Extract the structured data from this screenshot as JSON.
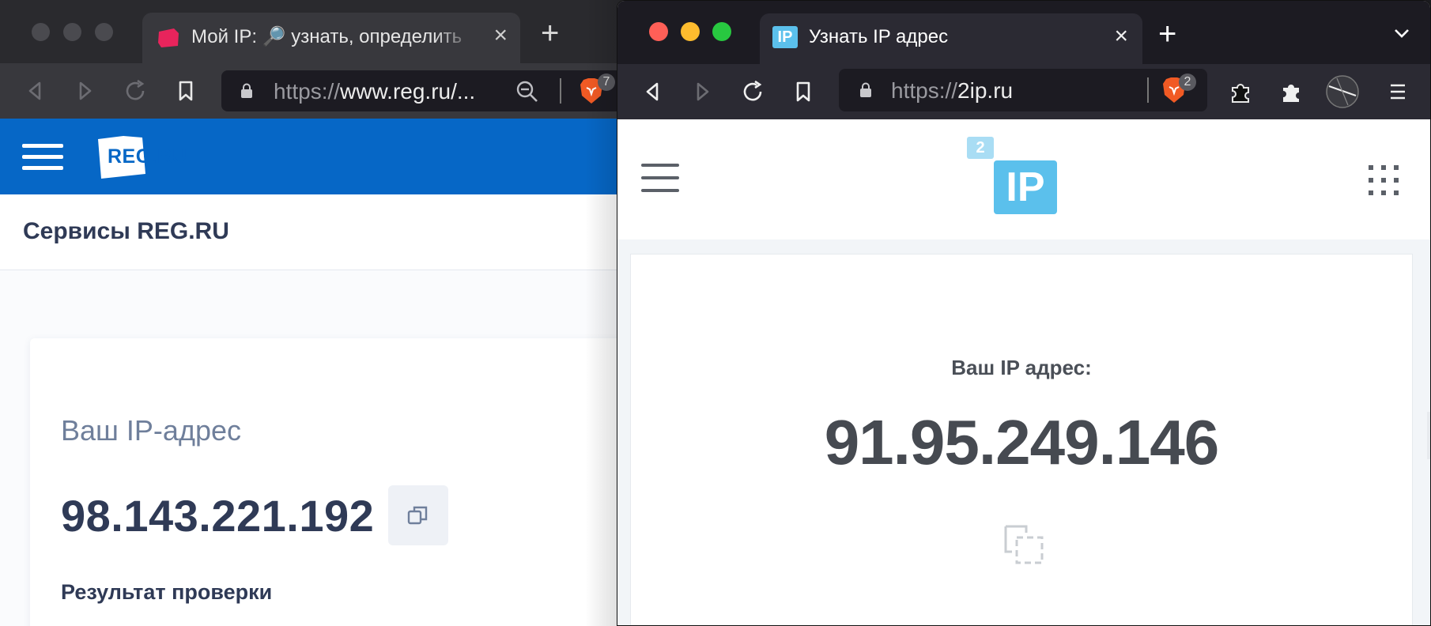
{
  "left_window": {
    "tab": {
      "title": "Мой IP: 🔎 узнать, определить",
      "close_icon": "×"
    },
    "new_tab_icon": "+",
    "url": {
      "prefix": "https://",
      "host": "www.reg.ru/..."
    },
    "brave_badge": "7",
    "site": {
      "logo_text": "REG.RU",
      "services_title": "Сервисы REG.RU",
      "ip_label": "Ваш IP-адрес",
      "ip_value": "98.143.221.192",
      "check_result_label": "Результат проверки"
    },
    "colors": {
      "header_blue": "#0667c6",
      "text_dark": "#2f3a56"
    }
  },
  "right_window": {
    "tab": {
      "favicon_text": "IP",
      "title": "Узнать IP адрес",
      "close_icon": "×"
    },
    "new_tab_icon": "+",
    "url": {
      "prefix": "https://",
      "host": "2ip.ru"
    },
    "brave_badge": "2",
    "site": {
      "logo_small": "2",
      "logo_main": "IP",
      "ip_label": "Ваш IP адрес:",
      "ip_value": "91.95.249.146"
    },
    "colors": {
      "accent": "#5bc0ec",
      "traffic_red": "#ff5f57",
      "traffic_yellow": "#febc2e",
      "traffic_green": "#28c840"
    }
  }
}
